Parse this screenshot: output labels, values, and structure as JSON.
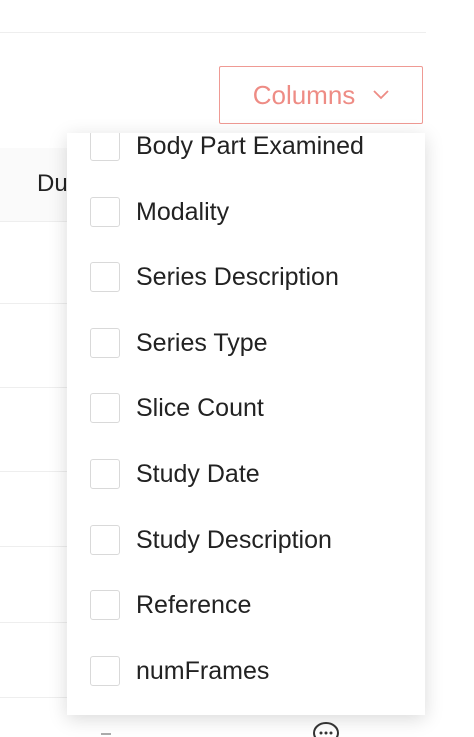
{
  "toolbar": {
    "columns_label": "Columns",
    "chevron_icon": "chevron-down-icon",
    "accent_color": "#ee8c85"
  },
  "table": {
    "header_partial": "Du"
  },
  "columns_menu": {
    "items": [
      {
        "label": "Body Part Examined",
        "checked": false
      },
      {
        "label": "Modality",
        "checked": false
      },
      {
        "label": "Series Description",
        "checked": false
      },
      {
        "label": "Series Type",
        "checked": false
      },
      {
        "label": "Slice Count",
        "checked": false
      },
      {
        "label": "Study Date",
        "checked": false
      },
      {
        "label": "Study Description",
        "checked": false
      },
      {
        "label": "Reference",
        "checked": false
      },
      {
        "label": "numFrames",
        "checked": false
      }
    ]
  },
  "footer": {
    "comment_icon": "comment-icon"
  }
}
